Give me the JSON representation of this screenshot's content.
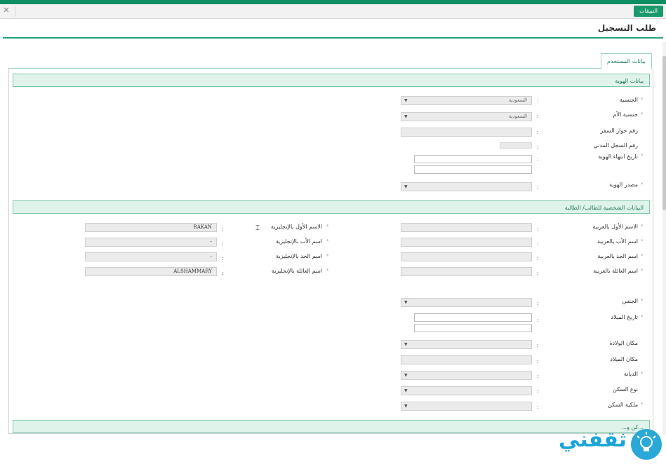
{
  "topbar": {
    "apps_tab": "التبيقات",
    "close": "✕"
  },
  "page": {
    "title": "طلب التسجيل"
  },
  "tab": {
    "label": "بيانات المستخدم"
  },
  "sections": {
    "identity": "بيانات الهوية",
    "personal": "البيانات الشخصية للطالب/ الطالبة",
    "next": "...كن و..."
  },
  "identity": {
    "nationality": {
      "label": "الجنسية",
      "value": "السعودية"
    },
    "mother_nationality": {
      "label": "جنسية الأم",
      "value": "السعودية"
    },
    "passport": {
      "label": "رقم جواز السفر",
      "value": ""
    },
    "civil_record": {
      "label": "رقم السجل المدني",
      "value": ""
    },
    "id_expiry": {
      "label": "تاريخ انتهاء الهوية"
    },
    "id_source": {
      "label": "مصدر الهوية"
    }
  },
  "personal_ar": {
    "first_name": {
      "label": "الاسم الأول بالعربية"
    },
    "father_name": {
      "label": "اسم الأب بالعربية"
    },
    "grandfather_name": {
      "label": "اسم الجد بالعربية"
    },
    "family_name": {
      "label": "اسم العائلة بالعربية"
    }
  },
  "personal_en": {
    "first_name": {
      "label": "الاسم الأول بالإنجليزية",
      "value": "RAKAN"
    },
    "father_name": {
      "label": "اسم الأب بالإنجليزية",
      "value": "-"
    },
    "grandfather_name": {
      "label": "اسم الجد بالإنجليزية",
      "value": "-"
    },
    "family_name": {
      "label": "اسم العائلة بالإنجليزية",
      "value": "ALSHAMMARY"
    }
  },
  "other": {
    "gender": {
      "label": "الجنس"
    },
    "birth_date": {
      "label": "تاريخ الميلاد"
    },
    "birth_place_select": {
      "label": "مكان الولادة"
    },
    "birth_place": {
      "label": "مكان الميلاد"
    },
    "religion": {
      "label": "الديانة"
    },
    "residence_type": {
      "label": "نوع السكن"
    },
    "residence_ownership": {
      "label": "ملكية السكن"
    }
  },
  "colon": ":",
  "required_mark": "*",
  "logo": {
    "text": "ثقفني"
  },
  "colors": {
    "accent": "#0e8f63",
    "section_bg": "#dff3ea",
    "logo": "#1aa5d8"
  }
}
